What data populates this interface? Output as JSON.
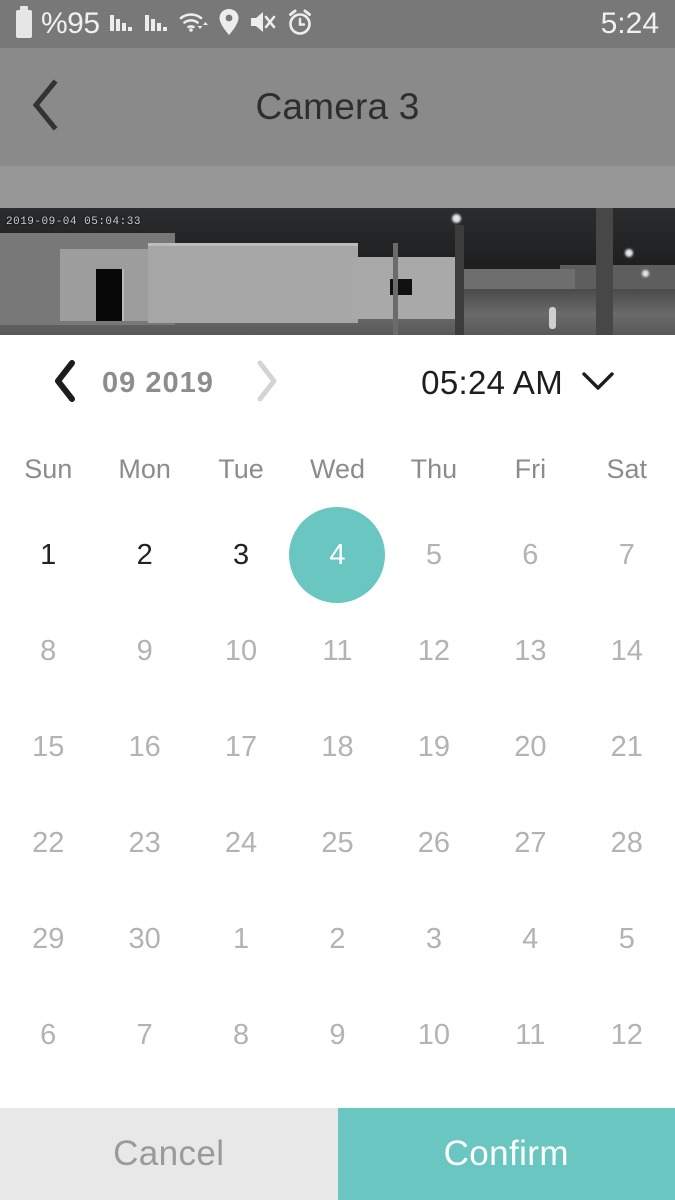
{
  "statusbar": {
    "battery_label": "%95",
    "time": "5:24",
    "icons": [
      "battery-icon",
      "signal-bars-icon",
      "signal-bars-2-icon",
      "wifi-icon",
      "location-pin-icon",
      "mute-icon",
      "alarm-clock-icon"
    ]
  },
  "titlebar": {
    "back_icon": "chevron-left-icon",
    "title": "Camera 3"
  },
  "camera": {
    "timestamp_overlay": "2019-09-04 05:04:33"
  },
  "picker": {
    "prev_icon": "chevron-left-icon",
    "next_icon": "chevron-right-icon",
    "month_year": "09  2019",
    "time": "05:24 AM",
    "time_caret_icon": "chevron-down-icon"
  },
  "calendar": {
    "weekdays": [
      "Sun",
      "Mon",
      "Tue",
      "Wed",
      "Thu",
      "Fri",
      "Sat"
    ],
    "weeks": [
      [
        {
          "d": "1",
          "state": "enabled"
        },
        {
          "d": "2",
          "state": "enabled"
        },
        {
          "d": "3",
          "state": "enabled"
        },
        {
          "d": "4",
          "state": "selected"
        },
        {
          "d": "5",
          "state": "disabled"
        },
        {
          "d": "6",
          "state": "disabled"
        },
        {
          "d": "7",
          "state": "disabled"
        }
      ],
      [
        {
          "d": "8",
          "state": "disabled"
        },
        {
          "d": "9",
          "state": "disabled"
        },
        {
          "d": "10",
          "state": "disabled"
        },
        {
          "d": "11",
          "state": "disabled"
        },
        {
          "d": "12",
          "state": "disabled"
        },
        {
          "d": "13",
          "state": "disabled"
        },
        {
          "d": "14",
          "state": "disabled"
        }
      ],
      [
        {
          "d": "15",
          "state": "disabled"
        },
        {
          "d": "16",
          "state": "disabled"
        },
        {
          "d": "17",
          "state": "disabled"
        },
        {
          "d": "18",
          "state": "disabled"
        },
        {
          "d": "19",
          "state": "disabled"
        },
        {
          "d": "20",
          "state": "disabled"
        },
        {
          "d": "21",
          "state": "disabled"
        }
      ],
      [
        {
          "d": "22",
          "state": "disabled"
        },
        {
          "d": "23",
          "state": "disabled"
        },
        {
          "d": "24",
          "state": "disabled"
        },
        {
          "d": "25",
          "state": "disabled"
        },
        {
          "d": "26",
          "state": "disabled"
        },
        {
          "d": "27",
          "state": "disabled"
        },
        {
          "d": "28",
          "state": "disabled"
        }
      ],
      [
        {
          "d": "29",
          "state": "disabled"
        },
        {
          "d": "30",
          "state": "disabled"
        },
        {
          "d": "1",
          "state": "disabled"
        },
        {
          "d": "2",
          "state": "disabled"
        },
        {
          "d": "3",
          "state": "disabled"
        },
        {
          "d": "4",
          "state": "disabled"
        },
        {
          "d": "5",
          "state": "disabled"
        }
      ],
      [
        {
          "d": "6",
          "state": "disabled"
        },
        {
          "d": "7",
          "state": "disabled"
        },
        {
          "d": "8",
          "state": "disabled"
        },
        {
          "d": "9",
          "state": "disabled"
        },
        {
          "d": "10",
          "state": "disabled"
        },
        {
          "d": "11",
          "state": "disabled"
        },
        {
          "d": "12",
          "state": "disabled"
        }
      ]
    ]
  },
  "footer": {
    "cancel_label": "Cancel",
    "confirm_label": "Confirm"
  },
  "colors": {
    "accent_teal": "#6ac6c1",
    "statusbar_gray": "#787878",
    "titlebar_gray": "#8a8a8a",
    "subbar_gray": "#979797",
    "cancel_gray": "#e8e8e8"
  }
}
